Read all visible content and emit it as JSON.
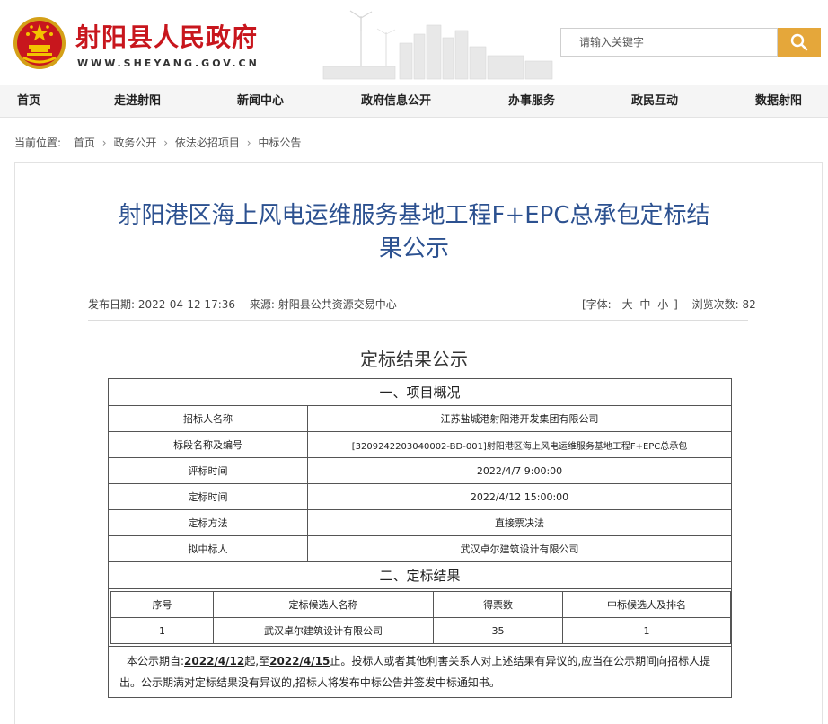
{
  "header": {
    "site_title": "射阳县人民政府",
    "site_url": "WWW.SHEYANG.GOV.CN",
    "search_placeholder": "请输入关键字"
  },
  "nav": {
    "items": [
      "首页",
      "走进射阳",
      "新闻中心",
      "政府信息公开",
      "办事服务",
      "政民互动",
      "数据射阳"
    ]
  },
  "breadcrumb": {
    "label": "当前位置:",
    "items": [
      "首页",
      "政务公开",
      "依法必招项目",
      "中标公告"
    ]
  },
  "article": {
    "title_line1": "射阳港区海上风电运维服务基地工程F+EPC总承包定标结",
    "title_line2": "果公示",
    "publish_label": "发布日期:",
    "publish_date": "2022-04-12 17:36",
    "source_label": "来源:",
    "source": "射阳县公共资源交易中心",
    "font_label": "[字体:",
    "font_large": "大",
    "font_medium": "中",
    "font_small": "小",
    "font_close": "]",
    "views_label": "浏览次数:",
    "views": "82"
  },
  "content": {
    "heading": "定标结果公示",
    "section1_title": "一、项目概况",
    "rows": [
      {
        "label": "招标人名称",
        "value": "江苏盐城港射阳港开发集团有限公司"
      },
      {
        "label": "标段名称及编号",
        "value": "[3209242203040002-BD-001]射阳港区海上风电运维服务基地工程F+EPC总承包"
      },
      {
        "label": "评标时间",
        "value": "2022/4/7 9:00:00"
      },
      {
        "label": "定标时间",
        "value": "2022/4/12 15:00:00"
      },
      {
        "label": "定标方法",
        "value": "直接票决法"
      },
      {
        "label": "拟中标人",
        "value": "武汉卓尔建筑设计有限公司"
      }
    ],
    "section2_title": "二、定标结果",
    "result_headers": [
      "序号",
      "定标候选人名称",
      "得票数",
      "中标候选人及排名"
    ],
    "result_rows": [
      [
        "1",
        "武汉卓尔建筑设计有限公司",
        "35",
        "1"
      ]
    ],
    "notice": {
      "part1": "本公示期自:",
      "start_date": "2022/4/12",
      "part2": "起,至",
      "end_date": "2022/4/15",
      "part3": "止。投标人或者其他利害关系人对上述结果有异议的,应当在公示期间向招标人提出。公示期满对定标结果没有异议的,招标人将发布中标公告并签发中标通知书。"
    }
  },
  "colors": {
    "brand_red": "#c8161d",
    "title_blue": "#2c5190",
    "search_orange": "#e5a73a"
  }
}
